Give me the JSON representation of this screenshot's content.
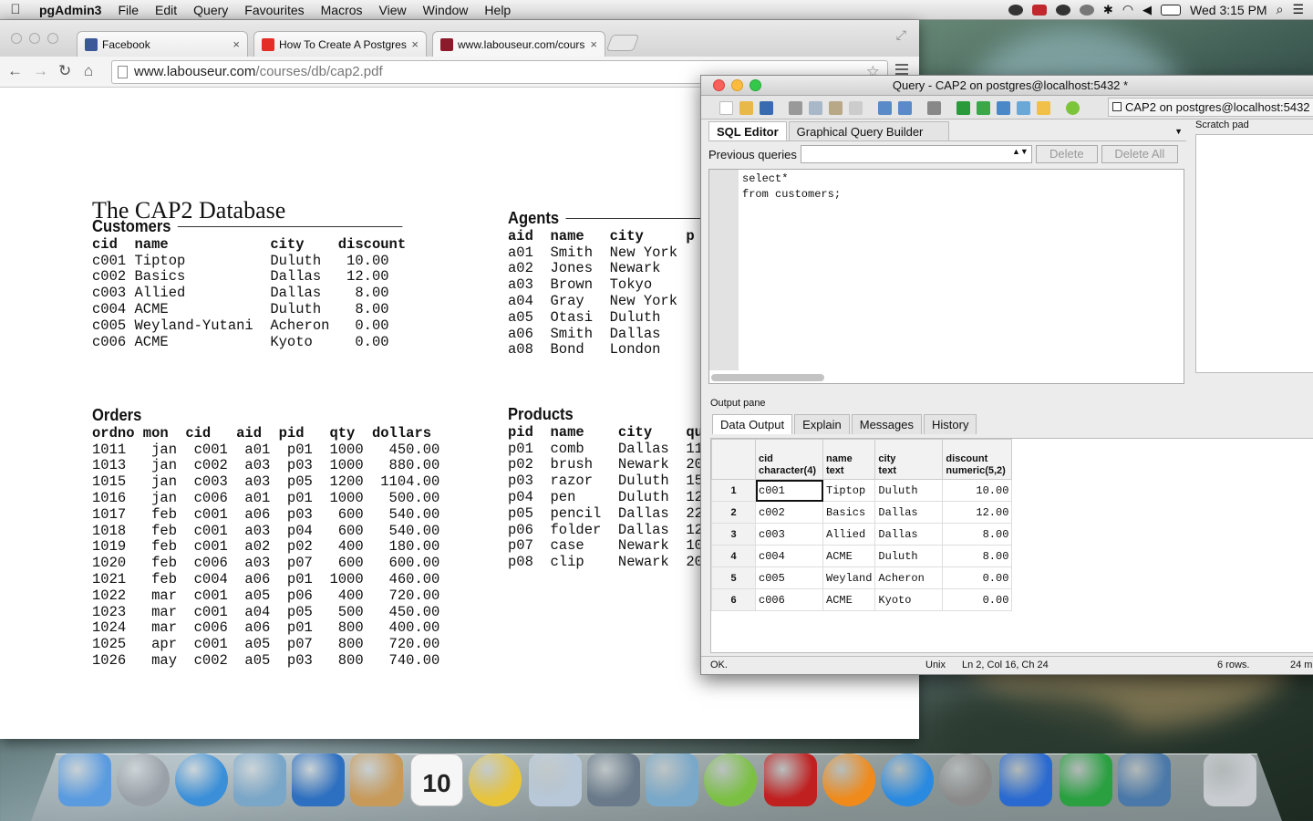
{
  "menubar": {
    "app": "pgAdmin3",
    "items": [
      "File",
      "Edit",
      "Query",
      "Favourites",
      "Macros",
      "View",
      "Window",
      "Help"
    ],
    "clock": "Wed 3:15 PM"
  },
  "browser": {
    "tabs": [
      {
        "title": "Facebook",
        "favicon_color": "#3b5998"
      },
      {
        "title": "How To Create A Postgres",
        "favicon_color": "#e52d27"
      },
      {
        "title": "www.labouseur.com/cours",
        "favicon_color": "#8b1a2b"
      }
    ],
    "url_host": "www.labouseur.com",
    "url_path": "/courses/db/cap2.pdf"
  },
  "pdf": {
    "title": "The CAP2 Database",
    "customers": {
      "heading": "Customers",
      "columns": "cid  name            city    discount",
      "rows": [
        "c001 Tiptop          Duluth   10.00",
        "c002 Basics          Dallas   12.00",
        "c003 Allied          Dallas    8.00",
        "c004 ACME            Duluth    8.00",
        "c005 Weyland-Yutani  Acheron   0.00",
        "c006 ACME            Kyoto     0.00"
      ]
    },
    "agents": {
      "heading": "Agents",
      "columns": "aid  name   city     p",
      "rows": [
        "a01  Smith  New York",
        "a02  Jones  Newark",
        "a03  Brown  Tokyo",
        "a04  Gray   New York",
        "a05  Otasi  Duluth",
        "a06  Smith  Dallas",
        "a08  Bond   London"
      ]
    },
    "orders": {
      "heading": "Orders",
      "columns": "ordno mon  cid   aid  pid   qty  dollars",
      "rows": [
        "1011   jan  c001  a01  p01  1000   450.00",
        "1013   jan  c002  a03  p03  1000   880.00",
        "1015   jan  c003  a03  p05  1200  1104.00",
        "1016   jan  c006  a01  p01  1000   500.00",
        "1017   feb  c001  a06  p03   600   540.00",
        "1018   feb  c001  a03  p04   600   540.00",
        "1019   feb  c001  a02  p02   400   180.00",
        "1020   feb  c006  a03  p07   600   600.00",
        "1021   feb  c004  a06  p01  1000   460.00",
        "1022   mar  c001  a05  p06   400   720.00",
        "1023   mar  c001  a04  p05   500   450.00",
        "1024   mar  c006  a06  p01   800   400.00",
        "1025   apr  c001  a05  p07   800   720.00",
        "1026   may  c002  a05  p03   800   740.00"
      ]
    },
    "products": {
      "heading": "Products",
      "columns": "pid  name    city    qua",
      "rows": [
        "p01  comb    Dallas  11",
        "p02  brush   Newark  20",
        "p03  razor   Duluth  15",
        "p04  pen     Duluth  12",
        "p05  pencil  Dallas  22",
        "p06  folder  Dallas  12",
        "p07  case    Newark  10",
        "p08  clip    Newark  20"
      ]
    }
  },
  "pgadmin": {
    "title": "Query - CAP2 on postgres@localhost:5432 *",
    "connection": "CAP2 on postgres@localhost:5432",
    "editor_tabs": [
      "SQL Editor",
      "Graphical Query Builder"
    ],
    "previous_queries_label": "Previous queries",
    "delete_label": "Delete",
    "delete_all_label": "Delete All",
    "sql": "select*\nfrom customers;",
    "scratch_label": "Scratch pad",
    "output_label": "Output pane",
    "output_tabs": [
      "Data Output",
      "Explain",
      "Messages",
      "History"
    ],
    "columns": [
      {
        "name": "cid",
        "type": "character(4)"
      },
      {
        "name": "name",
        "type": "text"
      },
      {
        "name": "city",
        "type": "text"
      },
      {
        "name": "discount",
        "type": "numeric(5,2)"
      }
    ],
    "rows": [
      {
        "n": "1",
        "cells": [
          "c001",
          "Tiptop",
          "Duluth",
          "10.00"
        ]
      },
      {
        "n": "2",
        "cells": [
          "c002",
          "Basics",
          "Dallas",
          "12.00"
        ]
      },
      {
        "n": "3",
        "cells": [
          "c003",
          "Allied",
          "Dallas",
          "8.00"
        ]
      },
      {
        "n": "4",
        "cells": [
          "c004",
          "ACME",
          "Duluth",
          "8.00"
        ]
      },
      {
        "n": "5",
        "cells": [
          "c005",
          "Weyland",
          "Acheron",
          "0.00"
        ]
      },
      {
        "n": "6",
        "cells": [
          "c006",
          "ACME",
          "Kyoto",
          "0.00"
        ]
      }
    ],
    "status": {
      "msg": "OK.",
      "eol": "Unix",
      "pos": "Ln 2, Col 16, Ch 24",
      "rows": "6 rows.",
      "time": "24 m"
    }
  },
  "dock": {
    "items": [
      {
        "icon": "finder-icon",
        "color": "#5a9be0"
      },
      {
        "icon": "launchpad-icon",
        "color": "#9aa0a8"
      },
      {
        "icon": "safari-icon",
        "color": "#3a8fd8"
      },
      {
        "icon": "mail-icon",
        "color": "#7aa6c8"
      },
      {
        "icon": "fetch-icon",
        "color": "#2d6fc0"
      },
      {
        "icon": "contacts-icon",
        "color": "#c89a5a"
      },
      {
        "icon": "calendar-icon",
        "color": "#f4f4f4"
      },
      {
        "icon": "chrome-icon",
        "color": "#e8c43a"
      },
      {
        "icon": "preview-icon",
        "color": "#b8c8d8"
      },
      {
        "icon": "facetime-icon",
        "color": "#6a7a8a"
      },
      {
        "icon": "iphoto-icon",
        "color": "#7aa8c8"
      },
      {
        "icon": "spotify-icon",
        "color": "#7bc043"
      },
      {
        "icon": "photobooth-icon",
        "color": "#c02020"
      },
      {
        "icon": "ibooks-icon",
        "color": "#f08a1a"
      },
      {
        "icon": "appstore-icon",
        "color": "#2a8ae0"
      },
      {
        "icon": "system-preferences-icon",
        "color": "#8a8a8a"
      },
      {
        "icon": "word-icon",
        "color": "#2a6ad0"
      },
      {
        "icon": "excel-icon",
        "color": "#2aa040"
      },
      {
        "icon": "pgadmin-icon",
        "color": "#4a78a8"
      },
      {
        "icon": "trash-icon",
        "color": "#c8ccd0"
      }
    ],
    "calendar_day": "10"
  }
}
